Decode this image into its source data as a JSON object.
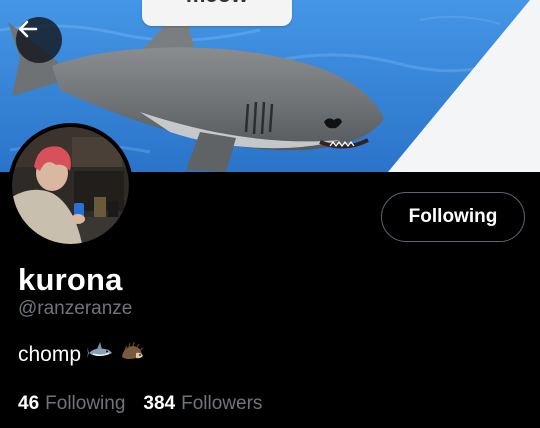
{
  "header": {
    "banner_caption": "meow",
    "back_icon": "arrow-left-icon"
  },
  "profile": {
    "display_name": "kurona",
    "handle": "@ranzeranze",
    "bio_text": "chomp",
    "bio_emojis": [
      "shark-emoji",
      "hedgehog-emoji"
    ],
    "follow_button_label": "Following"
  },
  "stats": {
    "following_count": "46",
    "following_label": "Following",
    "followers_count": "384",
    "followers_label": "Followers"
  },
  "colors": {
    "background": "#000000",
    "muted_text": "#6e767d",
    "button_border": "#5b6670",
    "banner_water": "#3f8fe0"
  }
}
